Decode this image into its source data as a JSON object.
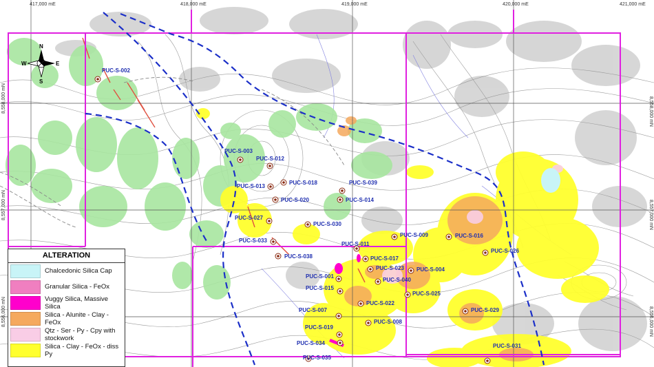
{
  "easting_labels": [
    "417,000 mE",
    "418,000 mE",
    "419,000 mE",
    "420,000 mE",
    "421,000 mE"
  ],
  "northing_labels": [
    "8,558,000 mN",
    "8,557,000 mN",
    "8,556,000 mN"
  ],
  "compass": {
    "n": "N",
    "s": "S",
    "e": "E",
    "w": "W"
  },
  "legend": {
    "title": "ALTERATION",
    "items": [
      {
        "label": "Chalcedonic Silica  Cap",
        "color": "#c8f4f7"
      },
      {
        "label": "Granular Silica - FeOx",
        "color": "#f07fc0"
      },
      {
        "label": "Vuggy Silica, Massive Silica",
        "color": "#ff00cc"
      },
      {
        "label": "Silica - Alunite - Clay - FeOx",
        "color": "#f5a95e"
      },
      {
        "label": "Qtz - Ser - Py - Cpy with stockwork",
        "color": "#f9cde6"
      },
      {
        "label": "Silica - Clay - FeOx - diss Py",
        "color": "#ffff2e"
      }
    ]
  },
  "drillholes": [
    {
      "id": "PUC-S-002"
    },
    {
      "id": "PUC-S-003"
    },
    {
      "id": "PUC-S-012"
    },
    {
      "id": "PUC-S-018"
    },
    {
      "id": "PUC-S-013"
    },
    {
      "id": "PUC-S-020"
    },
    {
      "id": "PUC-S-039"
    },
    {
      "id": "PUC-S-014"
    },
    {
      "id": "PUC-S-027"
    },
    {
      "id": "PUC-S-030"
    },
    {
      "id": "PUC-S-033"
    },
    {
      "id": "PUC-S-038"
    },
    {
      "id": "PUC-S-011"
    },
    {
      "id": "PUC-S-009"
    },
    {
      "id": "PUC-S-016"
    },
    {
      "id": "PUC-S-017"
    },
    {
      "id": "PUC-S-026"
    },
    {
      "id": "PUC-S-023"
    },
    {
      "id": "PUC-S-004"
    },
    {
      "id": "PUC-S-001"
    },
    {
      "id": "PUC-S-040"
    },
    {
      "id": "PUC-S-015"
    },
    {
      "id": "PUC-S-025"
    },
    {
      "id": "PUC-S-022"
    },
    {
      "id": "PUC-S-007"
    },
    {
      "id": "PUC-S-029"
    },
    {
      "id": "PUC-S-008"
    },
    {
      "id": "PUC-S-019"
    },
    {
      "id": "PUC-S-034"
    },
    {
      "id": "PUC-S-031"
    },
    {
      "id": "PUC-S-035"
    }
  ],
  "colors": {
    "magenta_outline": "#e020e0",
    "fault_blue": "#1b2fc8",
    "drill_label": "#1f2fb0",
    "outcrop_grey": "#cfcfcf",
    "green_alteration": "#a8e6a0"
  }
}
